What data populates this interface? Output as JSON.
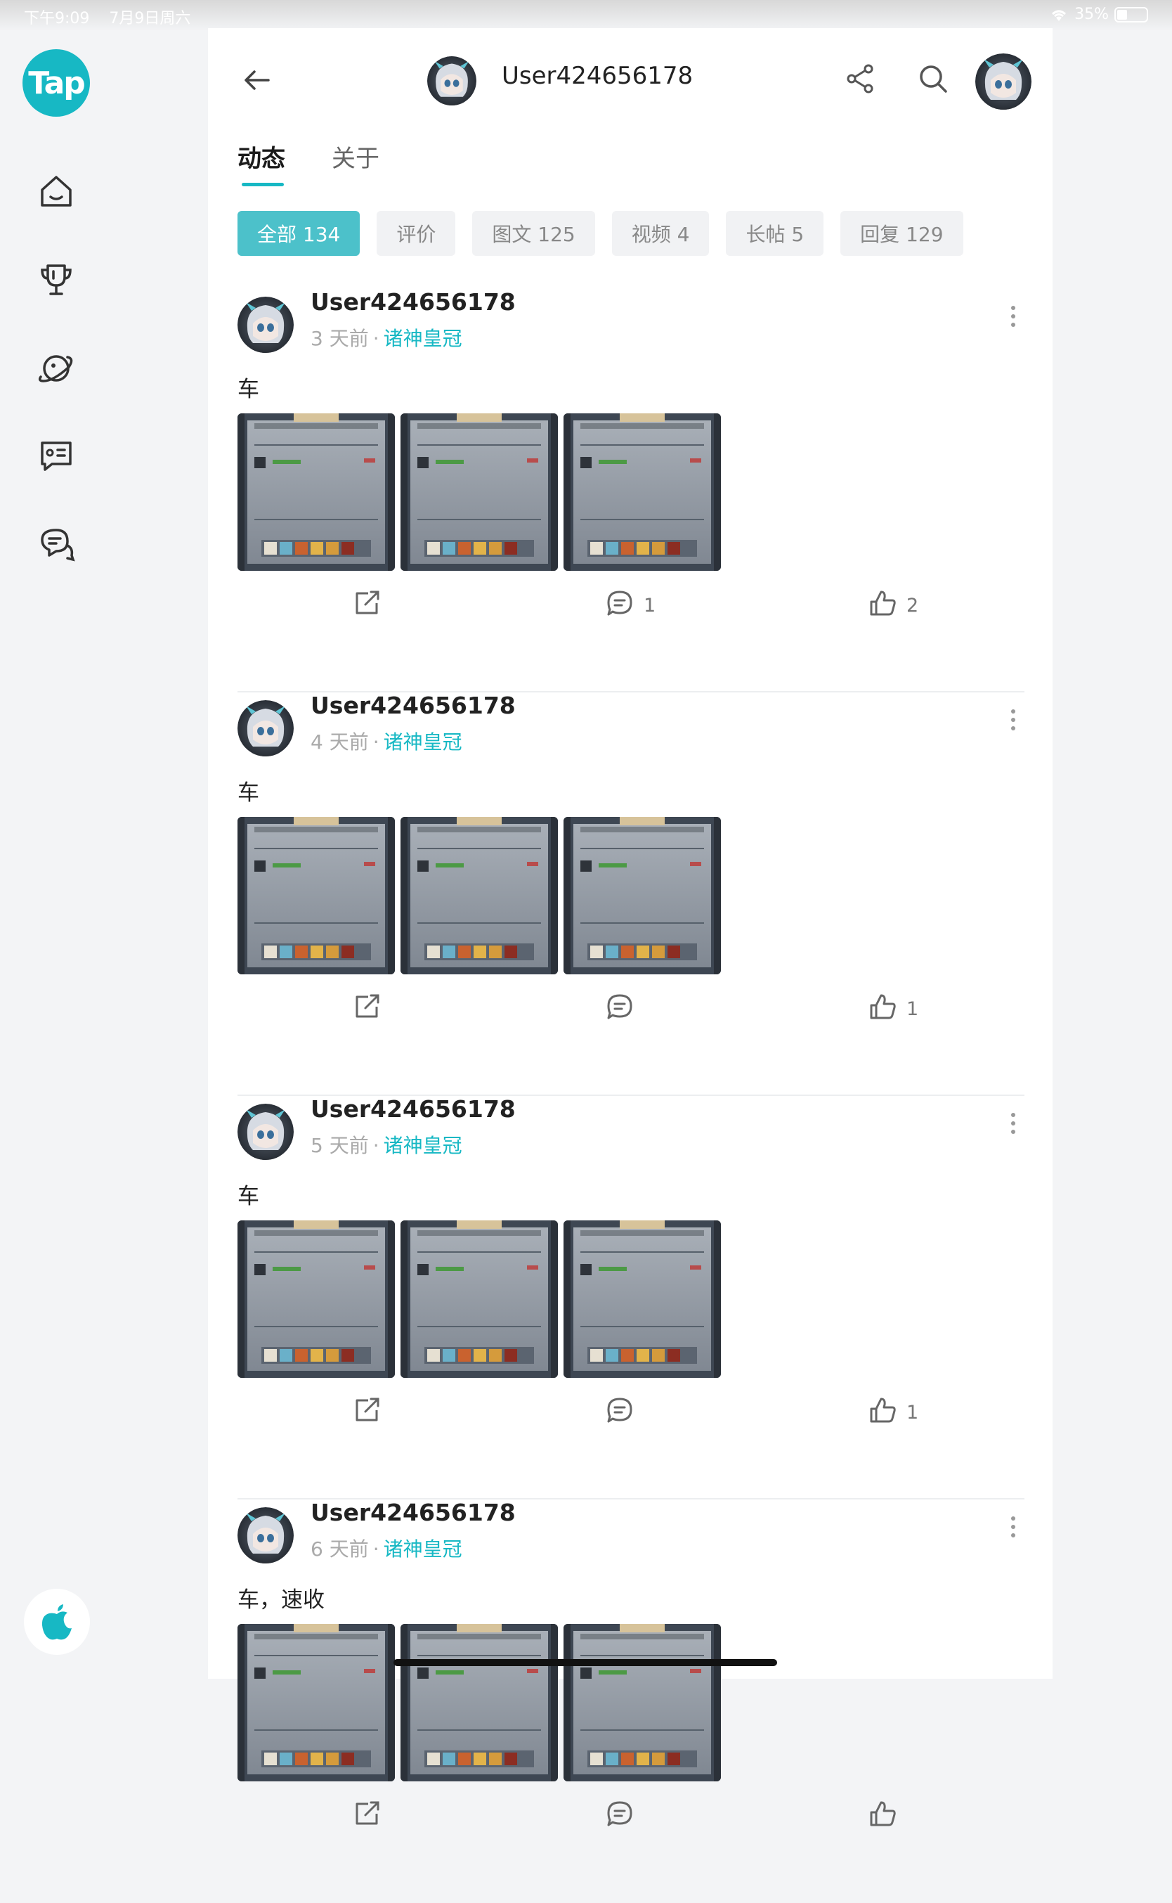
{
  "status_bar": {
    "time": "下午9:09",
    "date": "7月9日周六",
    "battery": "35%",
    "battery_level": 0.35
  },
  "sidebar": {
    "logo_text": "Tap",
    "items": [
      {
        "icon": "home-icon"
      },
      {
        "icon": "trophy-icon"
      },
      {
        "icon": "planet-icon"
      },
      {
        "icon": "message-card-icon"
      },
      {
        "icon": "chat-bubbles-icon"
      }
    ],
    "bottom_icon": "apple-icon"
  },
  "header": {
    "title": "User424656178"
  },
  "tabs": [
    {
      "label": "动态",
      "active": true
    },
    {
      "label": "关于",
      "active": false
    }
  ],
  "filters": [
    {
      "label": "全部 134",
      "active": true
    },
    {
      "label": "评价",
      "active": false
    },
    {
      "label": "图文 125",
      "active": false
    },
    {
      "label": "视频 4",
      "active": false
    },
    {
      "label": "长帖 5",
      "active": false
    },
    {
      "label": "回复 129",
      "active": false
    }
  ],
  "posts": [
    {
      "author": "User424656178",
      "time": "3 天前",
      "sep": "·",
      "game": "诸神皇冠",
      "text": "车",
      "comments": "1",
      "likes": "2"
    },
    {
      "author": "User424656178",
      "time": "4 天前",
      "sep": "·",
      "game": "诸神皇冠",
      "text": "车",
      "comments": "",
      "likes": "1"
    },
    {
      "author": "User424656178",
      "time": "5 天前",
      "sep": "·",
      "game": "诸神皇冠",
      "text": "车",
      "comments": "",
      "likes": "1"
    },
    {
      "author": "User424656178",
      "time": "6 天前",
      "sep": "·",
      "game": "诸神皇冠",
      "text": "车，速收",
      "comments": "",
      "likes": ""
    }
  ],
  "colors": {
    "accent": "#17b8c4",
    "chip_active": "#4cc1ca",
    "chip_bg": "#f1f2f4",
    "page_bg": "#f3f4f6"
  }
}
